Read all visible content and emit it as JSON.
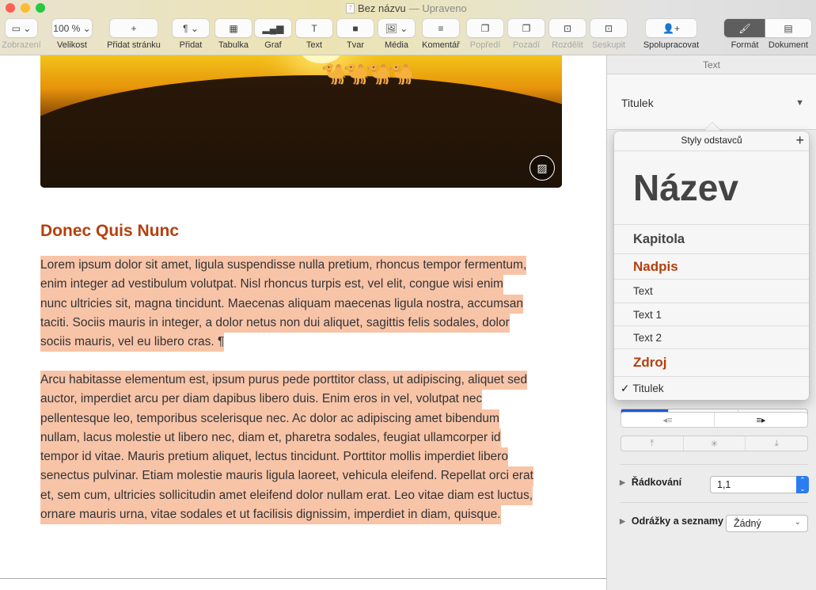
{
  "window": {
    "title": "Bez názvu",
    "status": "— Upraveno"
  },
  "toolbar": [
    {
      "label": "Zobrazení",
      "icon": "▭ ⌄"
    },
    {
      "label": "Velikost",
      "icon": "100 % ⌄"
    },
    {
      "label": "Přidat stránku",
      "icon": "+"
    },
    {
      "label": "Přidat",
      "icon": "¶ ⌄"
    },
    {
      "label": "Tabulka",
      "icon": "▦"
    },
    {
      "label": "Graf",
      "icon": "▂▄▆"
    },
    {
      "label": "Text",
      "icon": "T"
    },
    {
      "label": "Tvar",
      "icon": "■"
    },
    {
      "label": "Média",
      "icon": "🖼 ⌄"
    },
    {
      "label": "Komentář",
      "icon": "≡"
    },
    {
      "label": "Popředí",
      "icon": "❐"
    },
    {
      "label": "Pozadí",
      "icon": "❐"
    },
    {
      "label": "Rozdělit",
      "icon": "⊡"
    },
    {
      "label": "Seskupit",
      "icon": "⊡"
    },
    {
      "label": "Spolupracovat",
      "icon": "👤+"
    },
    {
      "label": "Formát",
      "icon": "🖌"
    },
    {
      "label": "Dokument",
      "icon": "▤"
    }
  ],
  "document": {
    "heading": "Donec Quis Nunc",
    "paragraph1": [
      "Lorem ipsum dolor sit amet, ligula suspendisse nulla pretium, rhoncus tempor fermentum,",
      "enim integer ad vestibulum volutpat. Nisl rhoncus turpis est, vel elit, congue wisi enim",
      "nunc ultricies sit, magna tincidunt. Maecenas aliquam maecenas ligula nostra, accumsan",
      "taciti. Sociis mauris in integer, a dolor netus non dui aliquet, sagittis felis sodales, dolor",
      "sociis mauris, vel eu libero cras. ¶"
    ],
    "paragraph2": [
      "Arcu habitasse elementum est, ipsum purus pede porttitor class, ut adipiscing, aliquet sed",
      "auctor, imperdiet arcu per diam dapibus libero duis. Enim eros in vel, volutpat nec",
      "pellentesque leo, temporibus scelerisque nec. Ac dolor ac adipiscing amet bibendum",
      "nullam, lacus molestie ut libero nec, diam et, pharetra sodales, feugiat ullamcorper id",
      "tempor id vitae. Mauris pretium aliquet, lectus tincidunt. Porttitor mollis imperdiet libero",
      "senectus pulvinar. Etiam molestie mauris ligula laoreet, vehicula eleifend. Repellat orci erat",
      "et, sem cum, ultricies sollicitudin amet eleifend dolor nullam erat. Leo vitae diam est luctus,",
      "ornare mauris urna, vitae sodales et ut facilisis dignissim, imperdiet in diam, quisque."
    ]
  },
  "sidebar": {
    "tab": "Text",
    "style": "Titulek",
    "line_spacing_label": "Řádkování",
    "line_spacing_value": "1,1",
    "bullets_label": "Odrážky a seznamy",
    "bullets_value": "Žádný"
  },
  "popover": {
    "title": "Styly odstavců",
    "add": "+",
    "check": "✓",
    "items": [
      "Název",
      "Kapitola",
      "Nadpis",
      "Text",
      "Text 1",
      "Text 2",
      "Zdroj",
      "Titulek"
    ],
    "selected": "Titulek"
  },
  "colors": {
    "accent": "#b5400e",
    "highlight": "#f8c4a8"
  }
}
